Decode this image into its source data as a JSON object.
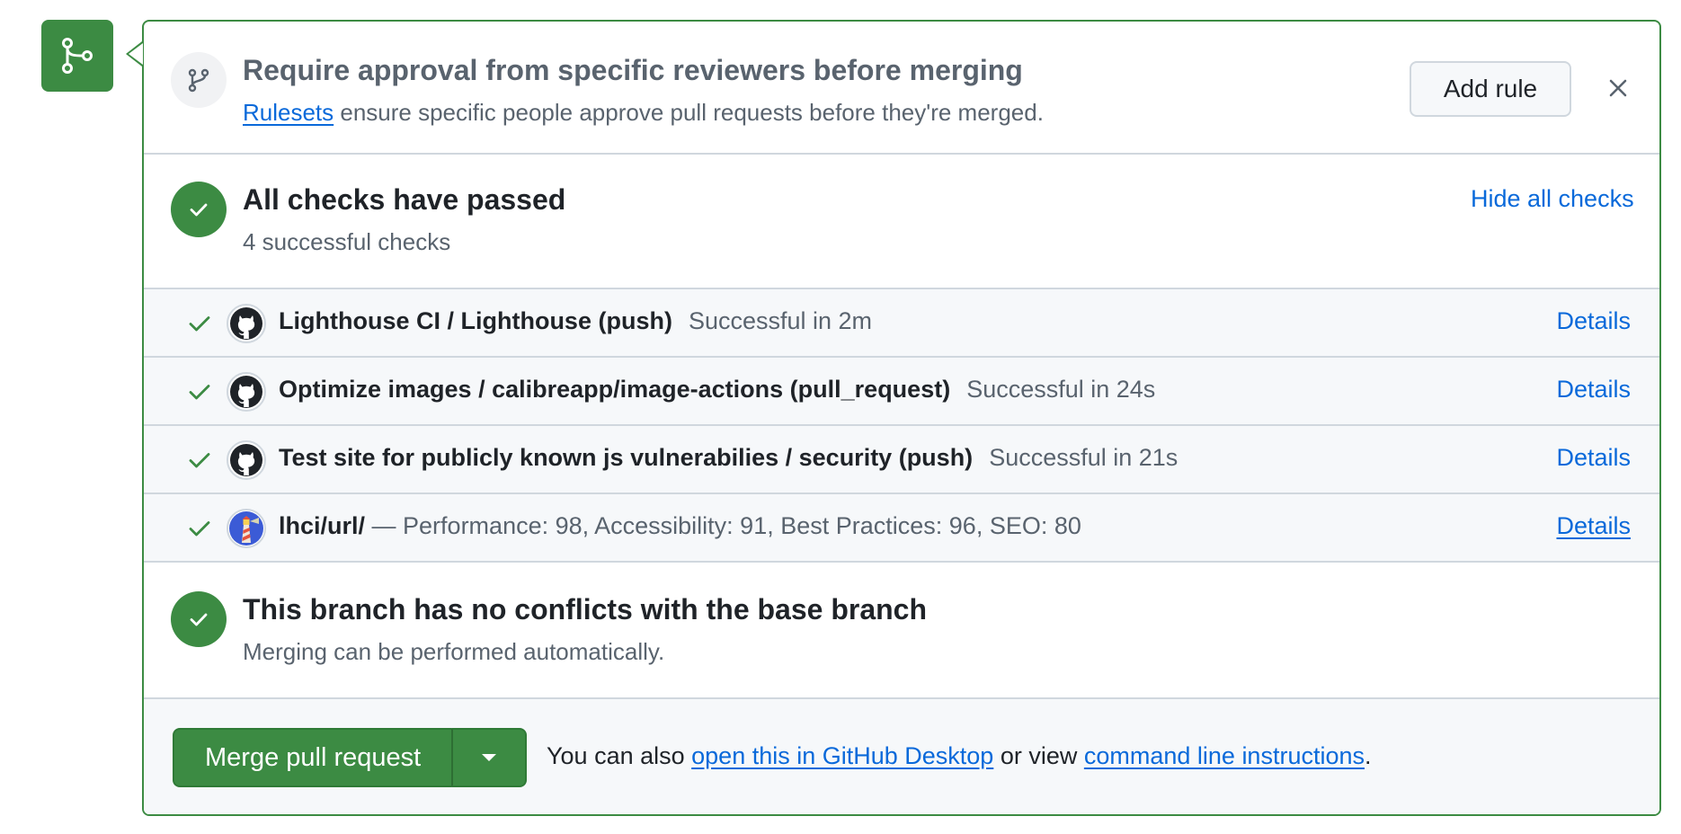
{
  "merge_badge": {
    "icon": "git-merge-icon"
  },
  "ruleset": {
    "icon": "git-branch-icon",
    "title": "Require approval from specific reviewers before merging",
    "link_text": "Rulesets",
    "description_rest": " ensure specific people approve pull requests before they're merged.",
    "add_rule_label": "Add rule",
    "close_icon": "close-icon"
  },
  "checks": {
    "title": "All checks have passed",
    "subtitle": "4 successful checks",
    "hide_label": "Hide all checks",
    "items": [
      {
        "name": "Lighthouse CI / Lighthouse (push)",
        "status": "Successful in 2m",
        "details": "Details",
        "avatar": "github-icon"
      },
      {
        "name": "Optimize images / calibreapp/image-actions (pull_request)",
        "status": "Successful in 24s",
        "details": "Details",
        "avatar": "github-icon"
      },
      {
        "name": "Test site for publicly known js vulnerabilies / security (push)",
        "status": "Successful in 21s",
        "details": "Details",
        "avatar": "github-icon"
      },
      {
        "name": "lhci/url/",
        "description": " — Performance: 98, Accessibility: 91, Best Practices: 96, SEO: 80",
        "details": "Details",
        "avatar": "lighthouse-icon"
      }
    ]
  },
  "conflicts": {
    "title": "This branch has no conflicts with the base branch",
    "subtitle": "Merging can be performed automatically."
  },
  "merge": {
    "button_label": "Merge pull request",
    "note_prefix": "You can also ",
    "desktop_link": "open this in GitHub Desktop",
    "note_middle": " or view ",
    "cli_link": "command line instructions",
    "note_suffix": "."
  },
  "colors": {
    "success": "#3c8b43",
    "link": "#0969da",
    "muted": "#59636e",
    "border": "#d0d7de"
  }
}
